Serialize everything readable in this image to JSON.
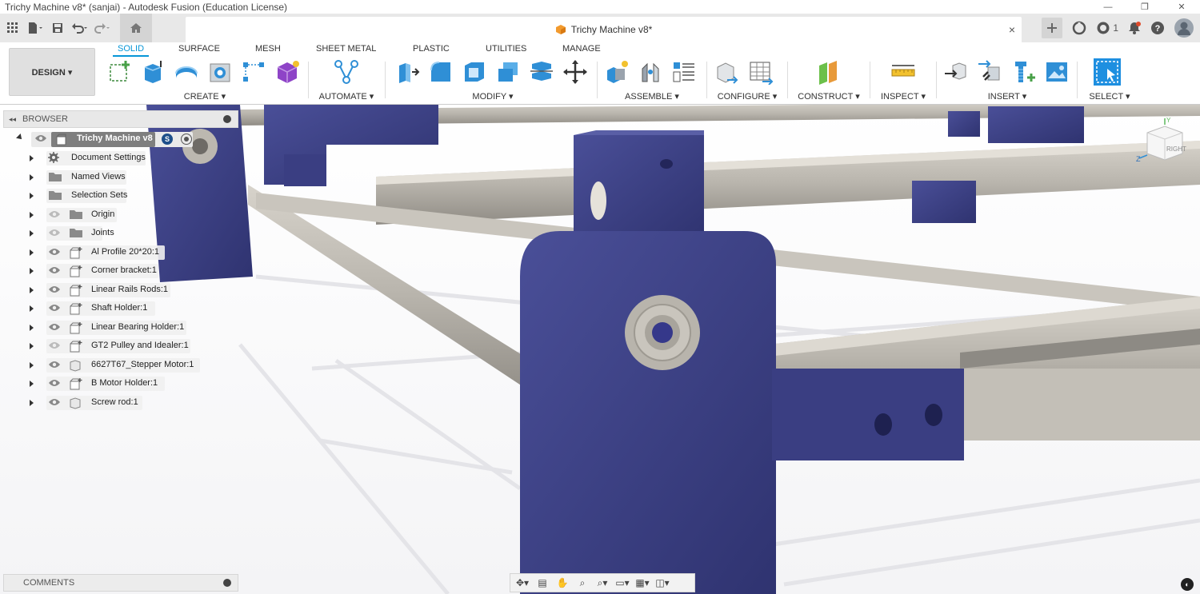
{
  "window": {
    "title": "Trichy Machine v8* (sanjai) - Autodesk Fusion (Education License)",
    "controls": {
      "minimize": "—",
      "maximize": "❐",
      "close": "✕"
    }
  },
  "tabbar": {
    "document_tab": "Trichy Machine v8*",
    "close_glyph": "×",
    "notification_count": "1"
  },
  "workspace": {
    "label": "DESIGN ▾"
  },
  "ribbon_tabs": [
    {
      "label": "SOLID",
      "active": true
    },
    {
      "label": "SURFACE"
    },
    {
      "label": "MESH"
    },
    {
      "label": "SHEET METAL"
    },
    {
      "label": "PLASTIC"
    },
    {
      "label": "UTILITIES"
    },
    {
      "label": "MANAGE"
    }
  ],
  "groups": {
    "create": "CREATE ▾",
    "automate": "AUTOMATE ▾",
    "modify": "MODIFY ▾",
    "assemble": "ASSEMBLE ▾",
    "configure": "CONFIGURE ▾",
    "construct": "CONSTRUCT ▾",
    "inspect": "INSPECT ▾",
    "insert": "INSERT ▾",
    "select": "SELECT ▾"
  },
  "browser": {
    "title": "BROWSER",
    "root": "Trichy Machine v8",
    "items": [
      {
        "label": "Document Settings",
        "icon": "gear-icon"
      },
      {
        "label": "Named Views",
        "icon": "folder-icon"
      },
      {
        "label": "Selection Sets",
        "icon": "folder-icon"
      },
      {
        "label": "Origin",
        "icon": "folder-icon"
      },
      {
        "label": "Joints",
        "icon": "folder-icon"
      },
      {
        "label": "Al Profile 20*20:1",
        "icon": "component-icon"
      },
      {
        "label": "Corner bracket:1",
        "icon": "component-icon"
      },
      {
        "label": "Linear Rails Rods:1",
        "icon": "component-icon"
      },
      {
        "label": "Shaft Holder:1",
        "icon": "component-icon"
      },
      {
        "label": "Linear Bearing Holder:1",
        "icon": "component-icon"
      },
      {
        "label": "GT2 Pulley and Idealer:1",
        "icon": "component-icon"
      },
      {
        "label": "6627T67_Stepper Motor:1",
        "icon": "body-icon"
      },
      {
        "label": "B Motor Holder:1",
        "icon": "component-icon"
      },
      {
        "label": "Screw rod:1",
        "icon": "body-icon"
      }
    ]
  },
  "comments": {
    "title": "COMMENTS"
  },
  "viewcube": {
    "face_label": "RIGHT",
    "axis_z": "Z",
    "axis_y": "Y"
  },
  "colors": {
    "accent": "#0696d7",
    "part_purple": "#3b3f86",
    "rail_grey": "#b9b5ad"
  }
}
